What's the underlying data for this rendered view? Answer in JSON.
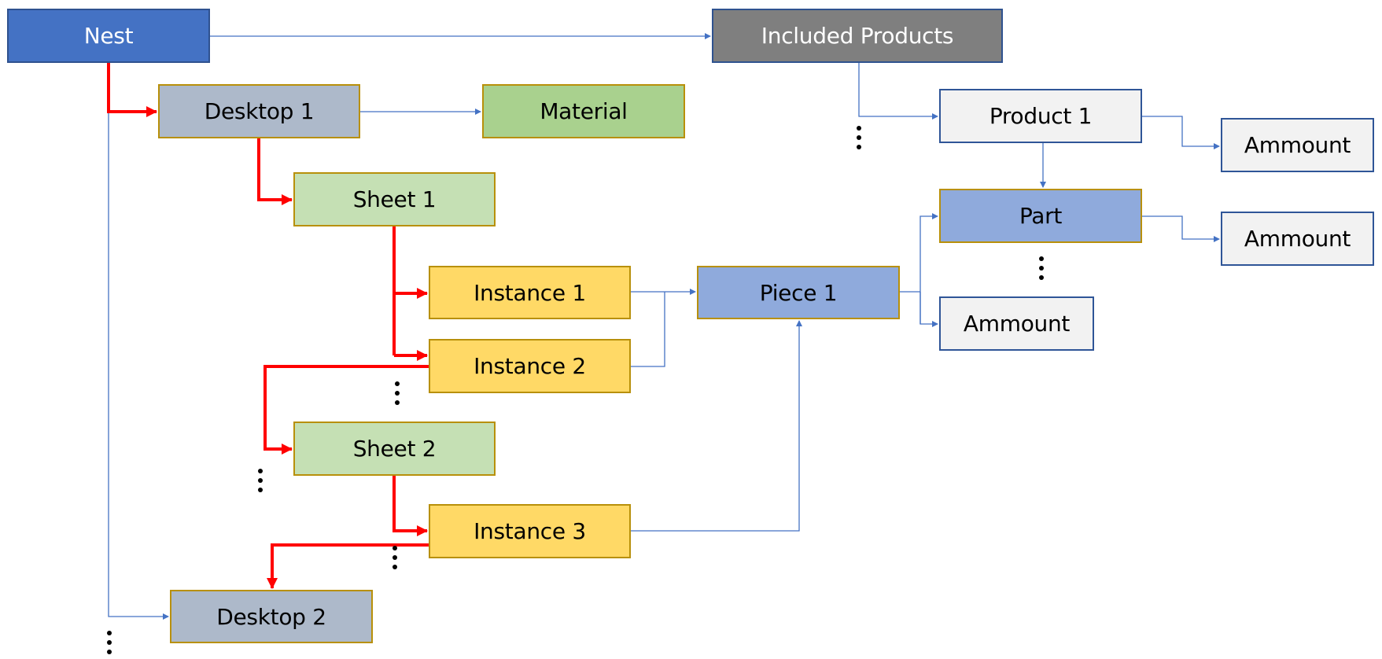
{
  "diagram": {
    "nodes": {
      "nest": "Nest",
      "included_products": "Included Products",
      "desktop_1": "Desktop 1",
      "material": "Material",
      "sheet_1": "Sheet 1",
      "instance_1": "Instance 1",
      "instance_2": "Instance 2",
      "piece_1": "Piece 1",
      "sheet_2": "Sheet 2",
      "instance_3": "Instance 3",
      "desktop_2": "Desktop 2",
      "product_1": "Product 1",
      "product_ammount": "Ammount",
      "part": "Part",
      "part_ammount": "Ammount",
      "piece_ammount": "Ammount"
    },
    "edges": [
      {
        "from": "nest",
        "to": "included_products",
        "style": "blue"
      },
      {
        "from": "nest",
        "to": "desktop_1",
        "style": "red"
      },
      {
        "from": "nest",
        "to": "desktop_2",
        "style": "blue"
      },
      {
        "from": "desktop_1",
        "to": "material",
        "style": "blue"
      },
      {
        "from": "desktop_1",
        "to": "sheet_1",
        "style": "red"
      },
      {
        "from": "sheet_1",
        "to": "instance_1",
        "style": "red"
      },
      {
        "from": "sheet_1",
        "to": "instance_2",
        "style": "red"
      },
      {
        "from": "instance_2",
        "to": "sheet_2",
        "style": "red"
      },
      {
        "from": "sheet_2",
        "to": "instance_3",
        "style": "red"
      },
      {
        "from": "instance_3",
        "to": "desktop_2",
        "style": "red"
      },
      {
        "from": "instance_1",
        "to": "piece_1",
        "style": "blue"
      },
      {
        "from": "instance_2",
        "to": "piece_1",
        "style": "blue"
      },
      {
        "from": "instance_3",
        "to": "piece_1",
        "style": "blue"
      },
      {
        "from": "piece_1",
        "to": "part",
        "style": "blue"
      },
      {
        "from": "piece_1",
        "to": "piece_ammount",
        "style": "blue"
      },
      {
        "from": "included_products",
        "to": "product_1",
        "style": "blue"
      },
      {
        "from": "product_1",
        "to": "product_ammount",
        "style": "blue"
      },
      {
        "from": "product_1",
        "to": "part",
        "style": "blue"
      },
      {
        "from": "part",
        "to": "part_ammount",
        "style": "blue"
      }
    ],
    "colors": {
      "traversal_edge": "#ff0000",
      "reference_edge": "#4472c4"
    }
  }
}
